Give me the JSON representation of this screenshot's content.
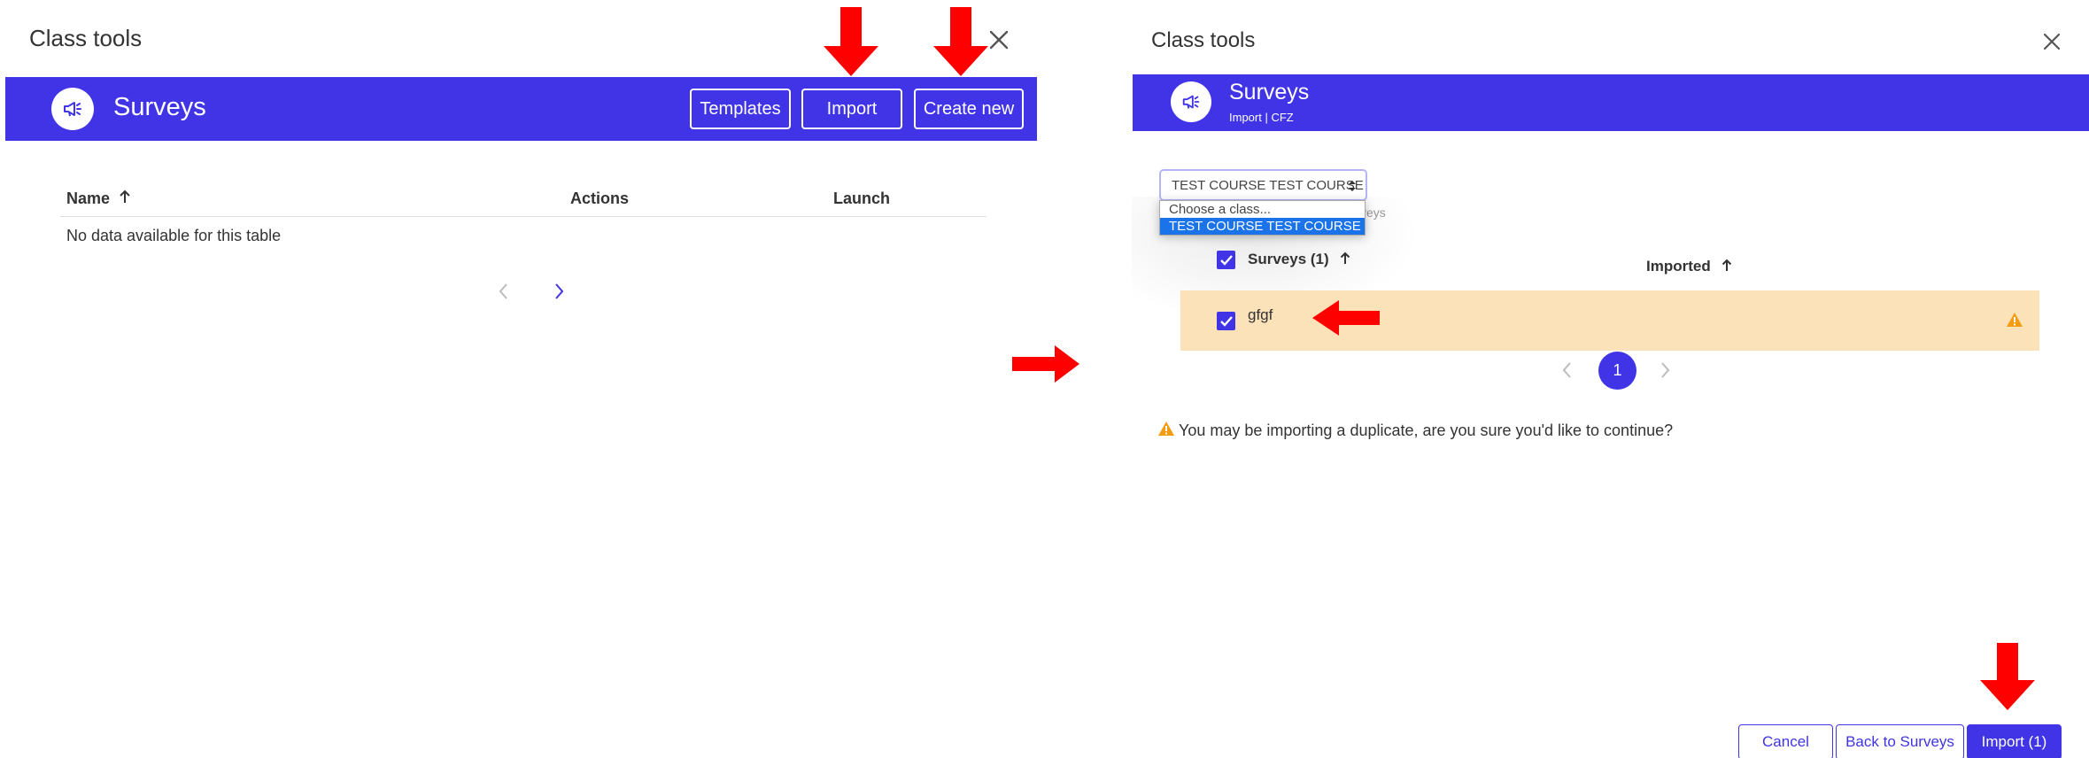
{
  "left": {
    "header": {
      "title": "Class tools"
    },
    "banner": {
      "title": "Surveys",
      "templates_label": "Templates",
      "import_label": "Import",
      "create_label": "Create new"
    },
    "table": {
      "columns": [
        "Name",
        "Actions",
        "Launch"
      ],
      "empty_text": "No data available for this table"
    }
  },
  "right": {
    "header": {
      "title": "Class tools"
    },
    "banner": {
      "title": "Surveys",
      "subtitle": "Import | CFZ"
    },
    "class_select": {
      "value": "TEST COURSE TEST COURSE",
      "options": [
        "Choose a class...",
        "TEST COURSE TEST COURSE"
      ],
      "obscured_text": "veys"
    },
    "table": {
      "columns": [
        "Surveys (1)",
        "Imported"
      ],
      "rows": [
        {
          "name": "gfgf",
          "checked": true,
          "duplicate_warning": true
        }
      ]
    },
    "pagination": {
      "current_page": "1"
    },
    "warning_text": "You may be importing a duplicate, are you sure you'd like to continue?",
    "footer": {
      "cancel_label": "Cancel",
      "back_label": "Back to Surveys",
      "import_label": "Import (1)"
    }
  },
  "colors": {
    "brand": "#4034e6",
    "warning": "#f39c12",
    "annotation": "#ff0000",
    "duplicate_row": "#fce2b9"
  }
}
